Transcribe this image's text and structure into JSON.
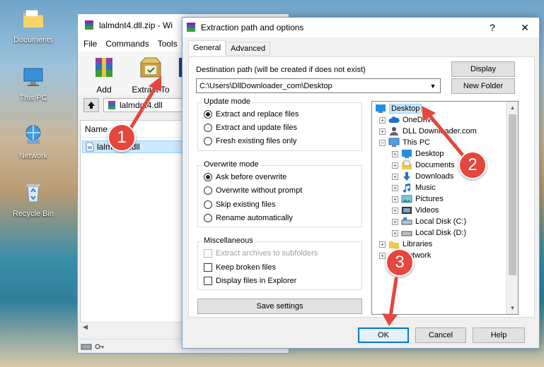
{
  "desktop": {
    "icons": [
      {
        "label": "Documents",
        "icon": "folder-icon"
      },
      {
        "label": "This PC",
        "icon": "computer-icon"
      },
      {
        "label": "Network",
        "icon": "network-icon"
      },
      {
        "label": "Recycle Bin",
        "icon": "recycle-bin-icon"
      }
    ]
  },
  "winrar": {
    "title": "lalmdnt4.dll.zip - Wi",
    "menu": [
      "File",
      "Commands",
      "Tools"
    ],
    "toolbar": {
      "add": "Add",
      "extract_to": "Extract To",
      "third": "T"
    },
    "path": "lalmdnt4.dll",
    "column_name": "Name",
    "file": "lalmdnt4.dll"
  },
  "dialog": {
    "title": "Extraction path and options",
    "help_glyph": "?",
    "close_glyph": "✕",
    "tabs": [
      "General",
      "Advanced"
    ],
    "dest_label": "Destination path (will be created if does not exist)",
    "dest_value": "C:\\Users\\DllDownloader_com\\Desktop",
    "display_btn": "Display",
    "new_folder_btn": "New Folder",
    "update_mode": {
      "title": "Update mode",
      "options": [
        "Extract and replace files",
        "Extract and update files",
        "Fresh existing files only"
      ],
      "selected": 0
    },
    "overwrite_mode": {
      "title": "Overwrite mode",
      "options": [
        "Ask before overwrite",
        "Overwrite without prompt",
        "Skip existing files",
        "Rename automatically"
      ],
      "selected": 0
    },
    "misc": {
      "title": "Miscellaneous",
      "options": [
        "Extract archives to subfolders",
        "Keep broken files",
        "Display files in Explorer"
      ]
    },
    "save_settings": "Save settings",
    "tree": [
      {
        "label": "Desktop",
        "icon": "desktop-icon"
      },
      {
        "label": "OneDrive",
        "icon": "cloud-icon"
      },
      {
        "label": "DLL Downloader.com",
        "icon": "user-icon"
      },
      {
        "label": "This PC",
        "icon": "computer-icon"
      },
      {
        "label": "Desktop",
        "icon": "desktop-icon"
      },
      {
        "label": "Documents",
        "icon": "documents-icon"
      },
      {
        "label": "Downloads",
        "icon": "downloads-icon"
      },
      {
        "label": "Music",
        "icon": "music-icon"
      },
      {
        "label": "Pictures",
        "icon": "pictures-icon"
      },
      {
        "label": "Videos",
        "icon": "videos-icon"
      },
      {
        "label": "Local Disk (C:)",
        "icon": "drive-icon"
      },
      {
        "label": "Local Disk (D:)",
        "icon": "drive-icon"
      },
      {
        "label": "Libraries",
        "icon": "libraries-icon"
      },
      {
        "label": "Network",
        "icon": "network-icon"
      }
    ],
    "ok": "OK",
    "cancel": "Cancel",
    "help": "Help"
  },
  "annotations": [
    "1",
    "2",
    "3"
  ],
  "colors": {
    "marker": "#e5473e",
    "selection": "#cce8ff",
    "accent": "#0078d7"
  }
}
